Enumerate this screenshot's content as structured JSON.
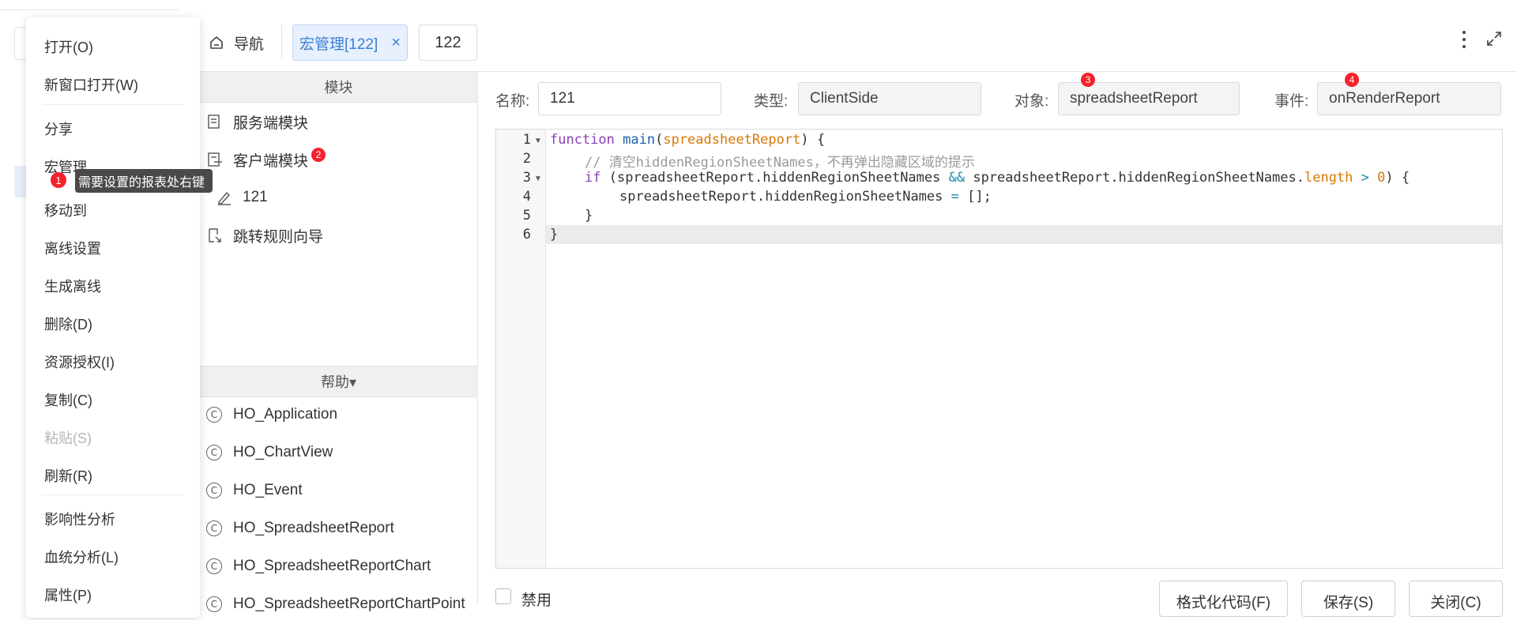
{
  "tabs": {
    "nav_label": "导航",
    "active_label": "宏管理[122]",
    "close_glyph": "×",
    "other_label": "122"
  },
  "module_panel": {
    "header": "模块",
    "items": [
      {
        "label": "服务端模块",
        "icon": "server-module-icon"
      },
      {
        "label": "客户端模块",
        "icon": "client-module-icon",
        "badge": "2"
      },
      {
        "label": "121",
        "icon": "script-edit-icon"
      },
      {
        "label": "跳转规则向导",
        "icon": "jump-rule-icon"
      }
    ],
    "help_header": "帮助▾",
    "help_items": [
      "HO_Application",
      "HO_ChartView",
      "HO_Event",
      "HO_SpreadsheetReport",
      "HO_SpreadsheetReportChart",
      "HO_SpreadsheetReportChartPoint"
    ],
    "class_glyph": "C"
  },
  "form": {
    "name_label": "名称:",
    "name_value": "121",
    "type_label": "类型:",
    "type_value": "ClientSide",
    "object_label": "对象:",
    "object_value": "spreadsheetReport",
    "object_badge": "3",
    "event_label": "事件:",
    "event_value": "onRenderReport",
    "event_badge": "4"
  },
  "editor": {
    "line_numbers": [
      "1",
      "2",
      "3",
      "4",
      "5",
      "6"
    ],
    "active_line": 6,
    "lines": {
      "l1_kw": "function",
      "l1_fn": "main",
      "l1_param": "spreadsheetReport",
      "l2_comment": "// 清空hiddenRegionSheetNames，不再弹出隐藏区域的提示",
      "l3_if": "if",
      "l3_a": "(spreadsheetReport.hiddenRegionSheetNames ",
      "l3_and": "&&",
      "l3_b": " spreadsheetReport.hiddenRegionSheetNames.",
      "l3_len": "length",
      "l3_gt": ">",
      "l3_zero": "0",
      "l3_end": ") {",
      "l4_a": "spreadsheetReport.hiddenRegionSheetNames ",
      "l4_eq": "=",
      "l4_b": " [];",
      "l5": "}",
      "l6": "}"
    }
  },
  "bottom": {
    "disable_label": "禁用",
    "format_button": "格式化代码(F)",
    "save_button": "保存(S)",
    "close_button": "关闭(C)"
  },
  "context_menu": {
    "items": [
      "打开(O)",
      "新窗口打开(W)",
      "分享",
      "宏管理",
      "移动到",
      "离线设置",
      "生成离线",
      "删除(D)",
      "资源授权(I)",
      "复制(C)",
      "粘贴(S)",
      "刷新(R)",
      "影响性分析",
      "血统分析(L)",
      "属性(P)"
    ],
    "disabled": [
      "粘贴(S)"
    ],
    "tooltip_badge": "1",
    "tooltip_text": "需要设置的报表处右键"
  },
  "colors": {
    "accent": "#3d7fd8",
    "badge_red": "#f5222d",
    "tab_active_bg": "#e7f0fc"
  }
}
